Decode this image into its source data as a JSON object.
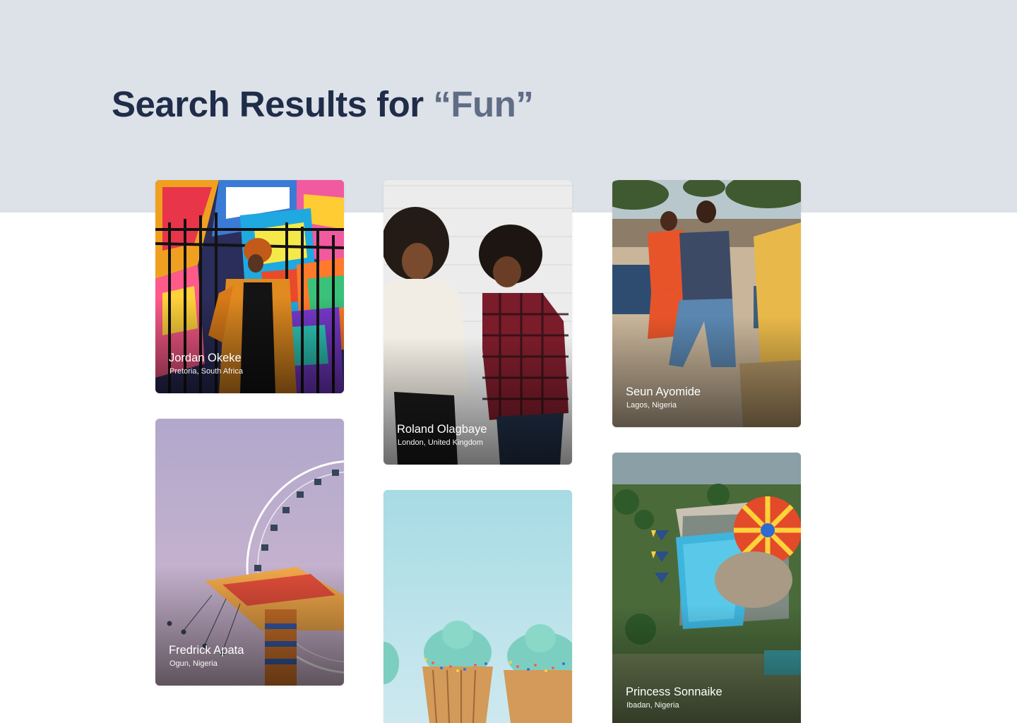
{
  "header": {
    "title_prefix": "Search Results for ",
    "query": "“Fun”"
  },
  "colors": {
    "header_band": "#dde1e8",
    "title": "#1f2d4a",
    "query": "#5f6d86",
    "caption_text": "#ffffff"
  },
  "results": [
    {
      "name": "Jordan Okeke",
      "location": "Pretoria, South Africa",
      "photo": "colorful-geometric-mural-photo"
    },
    {
      "name": "Roland Olagbaye",
      "location": "London, United Kingdom",
      "photo": "two-women-laughing-photo"
    },
    {
      "name": "Seun Ayomide",
      "location": "Lagos, Nigeria",
      "photo": "beach-friends-photo"
    },
    {
      "name": "Fredrick Apata",
      "location": "Ogun, Nigeria",
      "photo": "ferris-wheel-carousel-photo"
    },
    {
      "name": "",
      "location": "",
      "photo": "cupcakes-sprinkles-photo"
    },
    {
      "name": "Princess Sonnaike",
      "location": "Ibadan, Nigeria",
      "photo": "amusement-park-aerial-photo"
    }
  ]
}
